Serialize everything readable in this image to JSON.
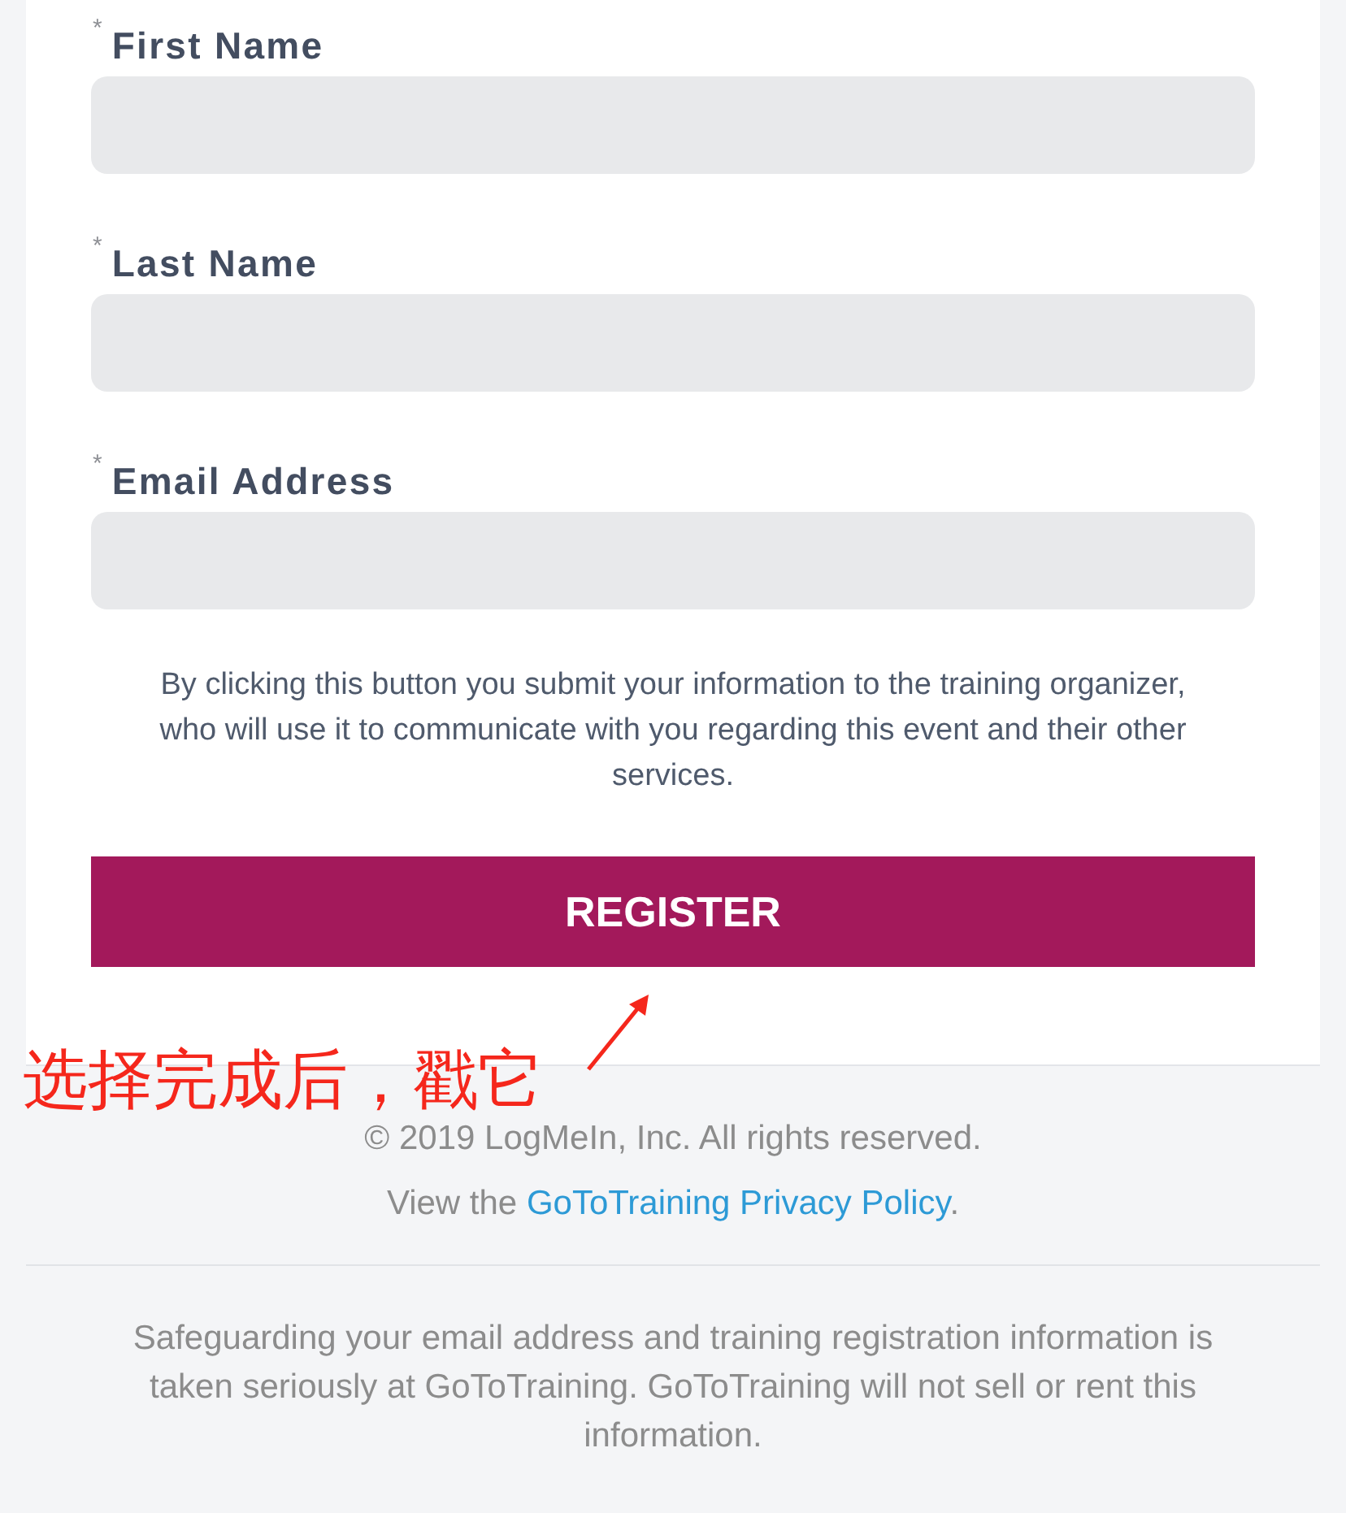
{
  "form": {
    "fields": [
      {
        "marker": "*",
        "label": "First Name"
      },
      {
        "marker": "*",
        "label": "Last Name"
      },
      {
        "marker": "*",
        "label": "Email Address"
      }
    ],
    "disclaimer": "By clicking this button you submit your information to the training organizer, who will use it to communicate with you regarding this event and their other services.",
    "submit_button": "REGISTER"
  },
  "footer": {
    "copyright": "© 2019 LogMeIn, Inc. All rights reserved.",
    "privacy": {
      "prefix": "View the",
      "link": "GoToTraining Privacy Policy",
      "suffix": "."
    },
    "notice": "Safeguarding your email address and training registration information is taken seriously at GoToTraining. GoToTraining will not sell or rent this information."
  },
  "annotation": {
    "text": "选择完成后，戳它"
  }
}
